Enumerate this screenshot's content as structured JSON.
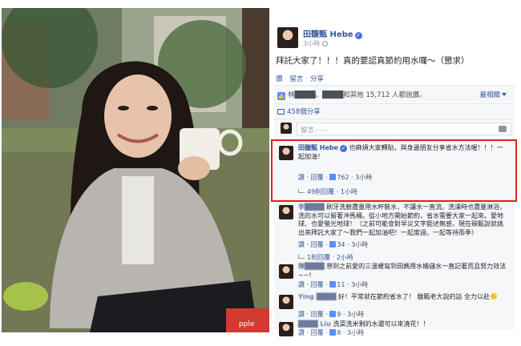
{
  "post": {
    "author": "田馥甄 Hebe",
    "time": "3小時",
    "text": "拜託大家了！！！真的要認真節約用水囉～（懇求）",
    "actions": {
      "like": "讚",
      "comment": "留言",
      "share": "分享"
    },
    "likes_text": "林████、████和其他 15,712 人都說讚。",
    "sort_label": "最相關",
    "shares_text": "458個分享",
    "comment_placeholder": "留言⋯⋯"
  },
  "comments": [
    {
      "author": "田馥甄 Hebe",
      "text": "也麻煩大家轉貼，與身邊朋友分享省水方法喔！！！一起加油！",
      "actions": "讚 · 回覆 · ",
      "likes": "762",
      "time": " · 3小時",
      "reply_text": "49則回覆 · 1小時",
      "highlighted": true
    },
    {
      "author": "李████",
      "text": "刷牙洗臉盡量用水杯裝水，不讓水一直流。洗澡時也盡量淋浴，洗的水可以留著沖馬桶。從小地方開始節約，省水需要大家一起來。愛地球、也愛螢光地球！（之前可能會對早災文字鉅述無感，現在碳甄說就挑出來拜託大家了～我們一起加油吧！一起度過、一起等待雨季）",
      "actions": "讚 · 回覆 · ",
      "likes": "34",
      "time": " · 3小時",
      "reply_text": "1則回覆 · 2小時"
    },
    {
      "author": "陳████",
      "text": "想到之前愛的三溫暖寫到田媽用水桶儲水一直記著而且努力效法~~!",
      "actions": "讚 · 回覆 · ",
      "likes": "11",
      "time": " · 3小時"
    },
    {
      "author": "Ying ████",
      "text": "好！平常就在節約省水了！ 馥甄老大說的話 全力以赴",
      "actions": "讚 · 回覆 · ",
      "likes": "9",
      "time": " · 3小時"
    },
    {
      "author": "████ Liu",
      "text": "洗菜洗米剩的水還可以來澆花！！",
      "actions": "讚 · 回覆 · ",
      "likes": "8",
      "time": " · 3小時"
    }
  ],
  "photo": {
    "cup_text": "pple"
  },
  "colors": {
    "link": "#365899",
    "highlight": "#e02020",
    "like": "#5890ff"
  }
}
